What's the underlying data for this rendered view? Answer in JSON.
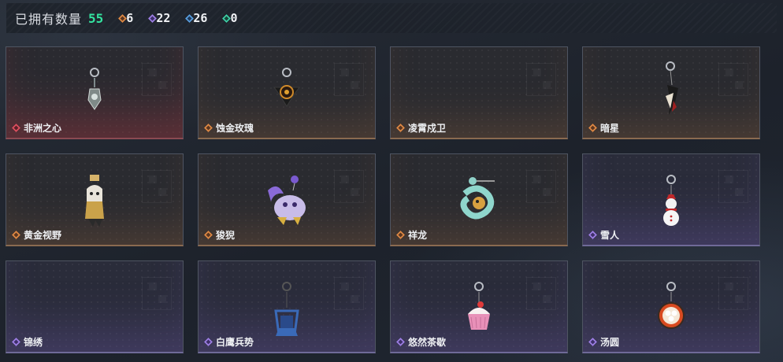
{
  "header": {
    "owned_label": "已拥有数量",
    "owned_count": "55",
    "stats": [
      {
        "rarity": "orange",
        "icon": "orange-rarity-icon",
        "value": "6"
      },
      {
        "rarity": "purple",
        "icon": "purple-rarity-icon",
        "value": "22"
      },
      {
        "rarity": "blue",
        "icon": "blue-rarity-icon",
        "value": "26"
      },
      {
        "rarity": "green",
        "icon": "green-rarity-icon",
        "value": "0"
      }
    ]
  },
  "colors": {
    "owned_count": "#34e3a0",
    "orange": "#e08a45",
    "red": "#e05060",
    "purple": "#9f80e6",
    "blue": "#5a9fe0",
    "green": "#3fd2a8"
  },
  "items": [
    {
      "name": "非洲之心",
      "rarity": "red"
    },
    {
      "name": "蚀金玫瑰",
      "rarity": "orange"
    },
    {
      "name": "凌霄戍卫",
      "rarity": "orange"
    },
    {
      "name": "暗星",
      "rarity": "orange"
    },
    {
      "name": "黄金视野",
      "rarity": "orange"
    },
    {
      "name": "狻猊",
      "rarity": "orange"
    },
    {
      "name": "祥龙",
      "rarity": "orange"
    },
    {
      "name": "雪人",
      "rarity": "purple"
    },
    {
      "name": "锦绣",
      "rarity": "purple"
    },
    {
      "name": "白鹰兵势",
      "rarity": "purple"
    },
    {
      "name": "悠然茶歇",
      "rarity": "purple"
    },
    {
      "name": "汤圆",
      "rarity": "purple"
    }
  ]
}
